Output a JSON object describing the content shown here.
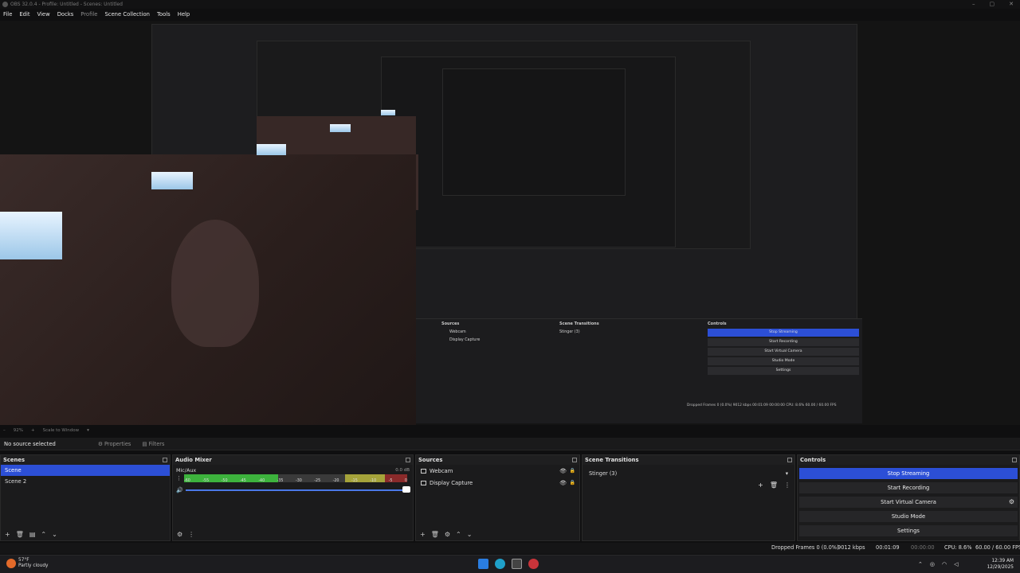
{
  "window": {
    "title": "OBS 32.0.4 - Profile: Untitled - Scenes: Untitled"
  },
  "menu": {
    "file": "File",
    "edit": "Edit",
    "view": "View",
    "docks": "Docks",
    "profile": "Profile",
    "scene_collection": "Scene Collection",
    "tools": "Tools",
    "help": "Help"
  },
  "zoom": {
    "level": "92%",
    "scale": "Scale to Window"
  },
  "source_bar": {
    "no_source": "No source selected",
    "properties": "Properties",
    "filters": "Filters"
  },
  "scenes": {
    "title": "Scenes",
    "items": [
      "Scene",
      "Scene 2"
    ]
  },
  "mixer": {
    "title": "Audio Mixer",
    "channel": "Mic/Aux",
    "db": "0.0 dB",
    "ticks": [
      "-60",
      "-55",
      "-50",
      "-45",
      "-40",
      "-35",
      "-30",
      "-25",
      "-20",
      "-15",
      "-10",
      "-5",
      "0"
    ],
    "volume": 1.0
  },
  "sources": {
    "title": "Sources",
    "items": [
      "Webcam",
      "Display Capture"
    ]
  },
  "transitions": {
    "title": "Scene Transitions",
    "selected": "Stinger (3)"
  },
  "controls": {
    "title": "Controls",
    "stop_streaming": "Stop Streaming",
    "start_recording": "Start Recording",
    "start_virtual_camera": "Start Virtual Camera",
    "studio_mode": "Studio Mode",
    "settings": "Settings"
  },
  "status": {
    "dropped": "Dropped Frames 0 (0.0%)",
    "bitrate": "9012 kbps",
    "stream_time": "00:01:09",
    "rec_time": "00:00:00",
    "cpu": "CPU: 8.6%",
    "fps": "60.00 / 60.00 FPS"
  },
  "inner_status": "Dropped Frames 0 (0.0%)  9012 kbps  00:01:09  00:00:00  CPU: 8.6%  60.00 / 60.00 FPS",
  "taskbar": {
    "temp": "57°F",
    "weather": "Partly cloudy",
    "time": "12:39 AM",
    "date": "12/29/2025"
  },
  "colors": {
    "accent": "#2c4fd6",
    "panel": "#1b1b1c"
  }
}
